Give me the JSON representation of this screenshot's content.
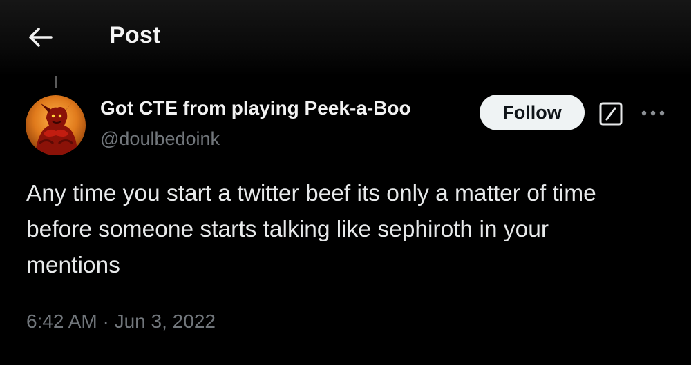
{
  "header": {
    "title": "Post",
    "back_icon": "arrow-left-icon"
  },
  "post": {
    "author": {
      "display_name": "Got CTE from playing Peek-a-Boo",
      "handle": "@doulbedoink"
    },
    "follow_label": "Follow",
    "text": "Any time you start a twitter beef its only a matter of time before someone starts talking like sephiroth in your mentions",
    "timestamp": "6:42 AM · Jun 3, 2022"
  },
  "icons": {
    "grok": "grok-icon",
    "more": "more-options-icon"
  },
  "colors": {
    "background": "#000000",
    "text_primary": "#e7e9ea",
    "text_secondary": "#71767b",
    "follow_button_bg": "#eff3f4",
    "follow_button_text": "#0f1419"
  }
}
